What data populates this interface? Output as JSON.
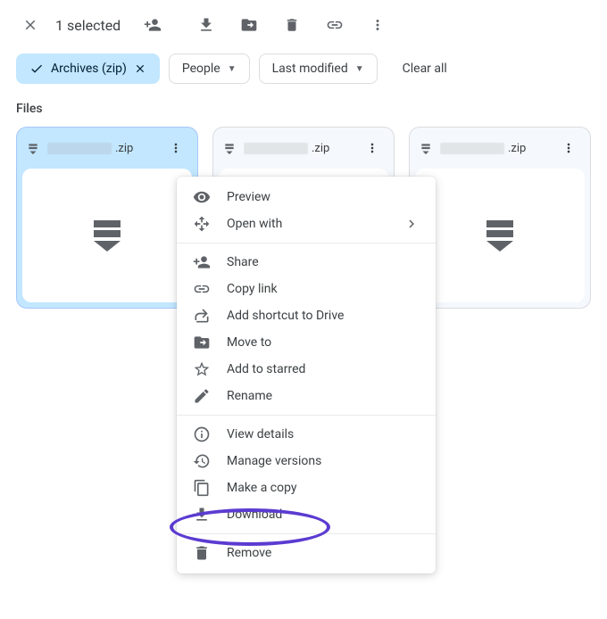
{
  "toolbar": {
    "selected_label": "1 selected"
  },
  "filters": {
    "chip_type": "Archives (zip)",
    "chip_people": "People",
    "chip_modified": "Last modified",
    "clear_all": "Clear all"
  },
  "section": {
    "files_title": "Files"
  },
  "files": [
    {
      "ext": ".zip"
    },
    {
      "ext": ".zip"
    },
    {
      "ext": ".zip"
    }
  ],
  "menu": {
    "preview": "Preview",
    "open_with": "Open with",
    "share": "Share",
    "copy_link": "Copy link",
    "add_shortcut": "Add shortcut to Drive",
    "move_to": "Move to",
    "add_starred": "Add to starred",
    "rename": "Rename",
    "view_details": "View details",
    "manage_versions": "Manage versions",
    "make_copy": "Make a copy",
    "download": "Download",
    "remove": "Remove"
  }
}
